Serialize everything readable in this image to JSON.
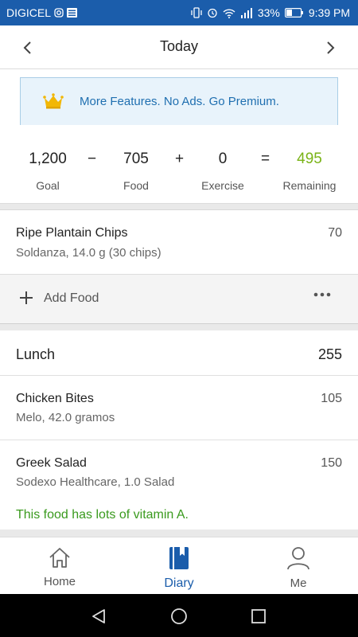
{
  "status_bar": {
    "carrier": "DIGICEL",
    "battery": "33%",
    "time": "9:39 PM"
  },
  "header": {
    "title": "Today"
  },
  "banner": {
    "text": "More Features. No Ads. Go Premium."
  },
  "summary": {
    "goal_value": "1,200",
    "goal_label": "Goal",
    "op1": "−",
    "food_value": "705",
    "food_label": "Food",
    "op2": "+",
    "exercise_value": "0",
    "exercise_label": "Exercise",
    "op3": "=",
    "remaining_value": "495",
    "remaining_label": "Remaining",
    "remaining_color": "#7ab317"
  },
  "snack_items": [
    {
      "name": "Ripe Plantain Chips",
      "detail": "Soldanza, 14.0 g (30 chips)",
      "calories": "70"
    }
  ],
  "add_food": {
    "label": "Add Food"
  },
  "lunch": {
    "title": "Lunch",
    "calories": "255",
    "items": [
      {
        "name": "Chicken Bites",
        "detail": "Melo, 42.0 gramos",
        "calories": "105"
      },
      {
        "name": "Greek Salad",
        "detail": "Sodexo Healthcare, 1.0 Salad",
        "calories": "150"
      }
    ],
    "note": "This food has lots of vitamin A.",
    "note_color": "#3a9a1e"
  },
  "bottom_nav": [
    {
      "label": "Home",
      "icon": "home-icon"
    },
    {
      "label": "Diary",
      "icon": "diary-icon"
    },
    {
      "label": "Me",
      "icon": "person-icon"
    }
  ],
  "colors": {
    "brand": "#1b5dab",
    "accent_green": "#7ab317"
  }
}
